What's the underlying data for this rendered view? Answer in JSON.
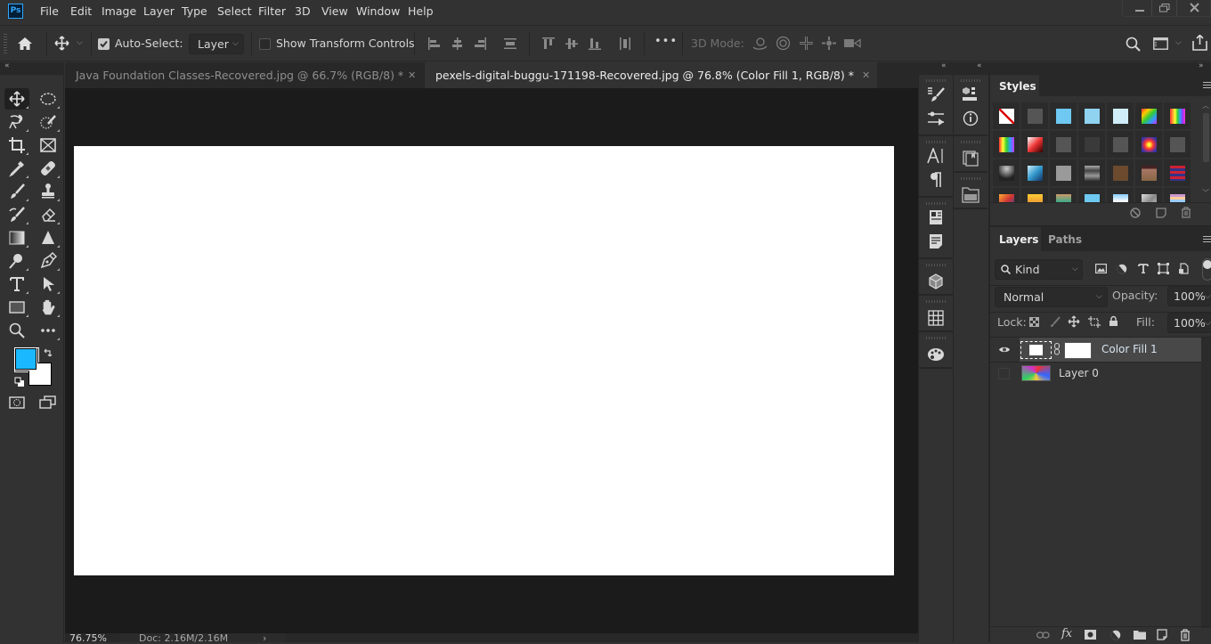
{
  "app": {
    "logo": "Ps",
    "name": "Photoshop"
  },
  "menu": [
    "File",
    "Edit",
    "Image",
    "Layer",
    "Type",
    "Select",
    "Filter",
    "3D",
    "View",
    "Window",
    "Help"
  ],
  "window_controls": [
    "minimize-icon",
    "restore-icon",
    "close-icon"
  ],
  "options_bar": {
    "auto_select_label": "Auto-Select:",
    "auto_select_checked": true,
    "auto_select_target": "Layer",
    "show_transform_label": "Show Transform Controls",
    "show_transform_checked": false,
    "more_label": "•••",
    "mode_3d_label": "3D Mode:",
    "align_icons": [
      "align-left-edges-icon",
      "align-horizontal-centers-icon",
      "align-right-edges-icon",
      "distribute-vertical-icon",
      "align-top-edges-icon",
      "align-vertical-centers-icon",
      "align-bottom-edges-icon",
      "distribute-horizontal-icon"
    ],
    "mode_3d_icons": [
      "orbit-3d-icon",
      "roll-3d-icon",
      "drag-3d-icon",
      "slide-3d-icon",
      "scale-3d-icon"
    ],
    "right_icons": [
      "search-icon",
      "workspace-icon",
      "share-icon"
    ]
  },
  "document_tabs": [
    {
      "title": "Java Foundation Classes-Recovered.jpg @ 66.7% (RGB/8) *",
      "active": false
    },
    {
      "title": "pexels-digital-buggu-171198-Recovered.jpg @ 76.8% (Color Fill 1, RGB/8) *",
      "active": true
    }
  ],
  "tools": [
    [
      "move-tool",
      "marquee-tool"
    ],
    [
      "lasso-tool",
      "quick-selection-tool"
    ],
    [
      "crop-tool",
      "frame-tool"
    ],
    [
      "eyedropper-tool",
      "healing-brush-tool"
    ],
    [
      "brush-tool",
      "clone-stamp-tool"
    ],
    [
      "history-brush-tool",
      "eraser-tool"
    ],
    [
      "gradient-tool",
      "blur-tool"
    ],
    [
      "dodge-tool",
      "pen-tool"
    ],
    [
      "type-tool",
      "path-selection-tool"
    ],
    [
      "rectangle-tool",
      "hand-tool"
    ],
    [
      "zoom-tool",
      "edit-toolbar"
    ]
  ],
  "colors": {
    "foreground": "#1ab9ff",
    "background": "#ffffff",
    "canvas": "#ffffff",
    "accent": "#31a8ff"
  },
  "canvas_zoom": "76.75%",
  "status": {
    "zoom": "76.75%",
    "doc": "Doc: 2.16M/2.16M",
    "arrow": "›"
  },
  "side_icons_col1": [
    "brush-settings-icon",
    "adjustments-sliders-icon",
    "character-icon",
    "paragraph-icon",
    "properties-icon",
    "notes-icon",
    "3d-icon",
    "grid-icon",
    "color-palette-icon"
  ],
  "side_icons_col2": [
    "libraries-icon",
    "info-icon",
    "swatch-book-icon",
    "layer-comps-icon"
  ],
  "styles_panel": {
    "tab": "Styles",
    "footer_icons": [
      "clear-style-icon",
      "new-style-icon",
      "delete-style-icon"
    ],
    "swatches": [
      [
        "none",
        "#555555",
        "#6ec8f2",
        "#8fd3f0",
        "#cfeefa",
        "rainbow",
        "rainbow-stripes"
      ],
      [
        "rainbow2",
        "red-gradient",
        "#555555",
        "#3a3a3a",
        "#555555",
        "radial",
        "#555555"
      ],
      [
        "dark-chrome",
        "blue-chrome",
        "#9a9a9a",
        "metal",
        "#6b4a2e",
        "wood",
        "red-blue"
      ],
      [
        "fire",
        "orange",
        "landscape",
        "#6ec8f2",
        "sky",
        "stone",
        "pastel"
      ]
    ]
  },
  "layers_panel": {
    "tabs": [
      "Layers",
      "Paths"
    ],
    "active_tab": "Layers",
    "filter_kind": "Kind",
    "blend_mode": "Normal",
    "opacity_label": "Opacity:",
    "opacity": "100%",
    "lock_label": "Lock:",
    "fill_label": "Fill:",
    "fill": "100%",
    "layers": [
      {
        "name": "Color Fill 1",
        "visible": true,
        "selected": true
      },
      {
        "name": "Layer 0",
        "visible": false,
        "selected": false
      }
    ],
    "footer_icons": [
      "link-layers-icon",
      "fx-icon",
      "add-mask-icon",
      "adjustment-layer-icon",
      "new-group-icon",
      "new-layer-icon",
      "delete-layer-icon"
    ]
  }
}
